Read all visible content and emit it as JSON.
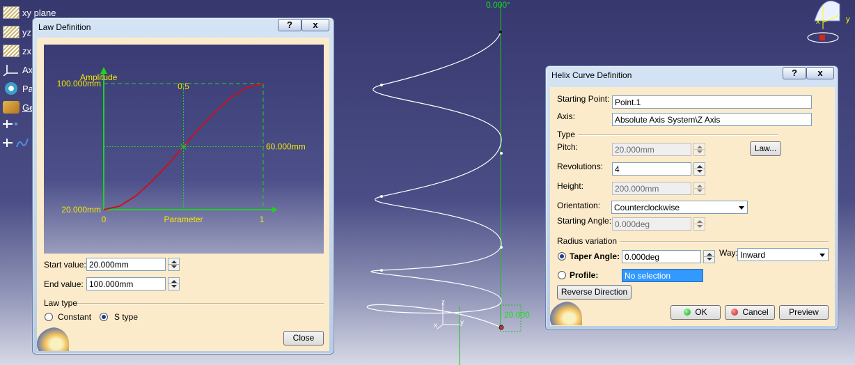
{
  "tree": {
    "items": [
      {
        "label": "xy plane",
        "icon": "plane-icon"
      },
      {
        "label": "yz",
        "icon": "plane-icon"
      },
      {
        "label": "zx",
        "icon": "plane-icon"
      },
      {
        "label": "Ax",
        "icon": "axis-system-icon"
      },
      {
        "label": "Pa",
        "icon": "parts-icon"
      },
      {
        "label": "Ge",
        "icon": "geometrical-set-icon"
      }
    ]
  },
  "viewport": {
    "angle_label": "0.000°",
    "radius_label": "20.000",
    "compass_axis_x": "x",
    "compass_axis_y": "y",
    "triad": {
      "x": "x",
      "y": "y",
      "z": "z"
    }
  },
  "law_dialog": {
    "title": "Law Definition",
    "help_button": "?",
    "close_x": "x",
    "start_value_label": "Start value:",
    "start_value": "20.000mm",
    "end_value_label": "End value:",
    "end_value": "100.000mm",
    "law_type_label": "Law type",
    "option_constant": "Constant",
    "option_s_type": "S type",
    "selected_type": "S type",
    "close_button": "Close"
  },
  "chart_data": {
    "type": "line",
    "ylabel": "Amplitude",
    "xlabel": "Parameter",
    "x_ticks": [
      "0",
      "1"
    ],
    "y_ticks": [
      "20.000mm",
      "100.000mm"
    ],
    "mid_x_label": "0.5",
    "mid_y_label": "60.000mm",
    "xlim": [
      0,
      1
    ],
    "ylim": [
      20,
      100
    ],
    "grid": false,
    "series": [
      {
        "x": [
          0,
          0.1,
          0.2,
          0.3,
          0.4,
          0.5,
          0.6,
          0.7,
          0.8,
          0.9,
          1.0
        ],
        "y": [
          20,
          22.3,
          28.6,
          37.8,
          48.3,
          60,
          71.7,
          82.2,
          91.4,
          97.7,
          100
        ],
        "color": "#c8121c"
      }
    ],
    "axis_color": "#1ed21e"
  },
  "helix_dialog": {
    "title": "Helix Curve Definition",
    "help_button": "?",
    "close_x": "x",
    "starting_point_label": "Starting Point:",
    "starting_point": "Point.1",
    "axis_label": "Axis:",
    "axis": "Absolute Axis System\\Z Axis",
    "type_label": "Type",
    "pitch_label": "Pitch:",
    "pitch": "20.000mm",
    "law_button": "Law...",
    "revolutions_label": "Revolutions:",
    "revolutions": "4",
    "height_label": "Height:",
    "height": "200.000mm",
    "orientation_label": "Orientation:",
    "orientation": "Counterclockwise",
    "starting_angle_label": "Starting Angle:",
    "starting_angle": "0.000deg",
    "radius_variation_label": "Radius variation",
    "taper_angle_label": "Taper Angle:",
    "taper_angle": "0.000deg",
    "way_label": "Way:",
    "way": "Inward",
    "profile_label": "Profile:",
    "profile": "No selection",
    "reverse_button": "Reverse Direction",
    "ok_button": "OK",
    "cancel_button": "Cancel",
    "preview_button": "Preview"
  },
  "colors": {
    "dialog_client": "#fcebca",
    "chart_bg": "#3d3e77",
    "chart_text": "#f2e800",
    "chart_axes": "#1ed21e",
    "curve": "#c8121c",
    "helix": "#ffffff",
    "viewport_axis": "#18c418"
  }
}
